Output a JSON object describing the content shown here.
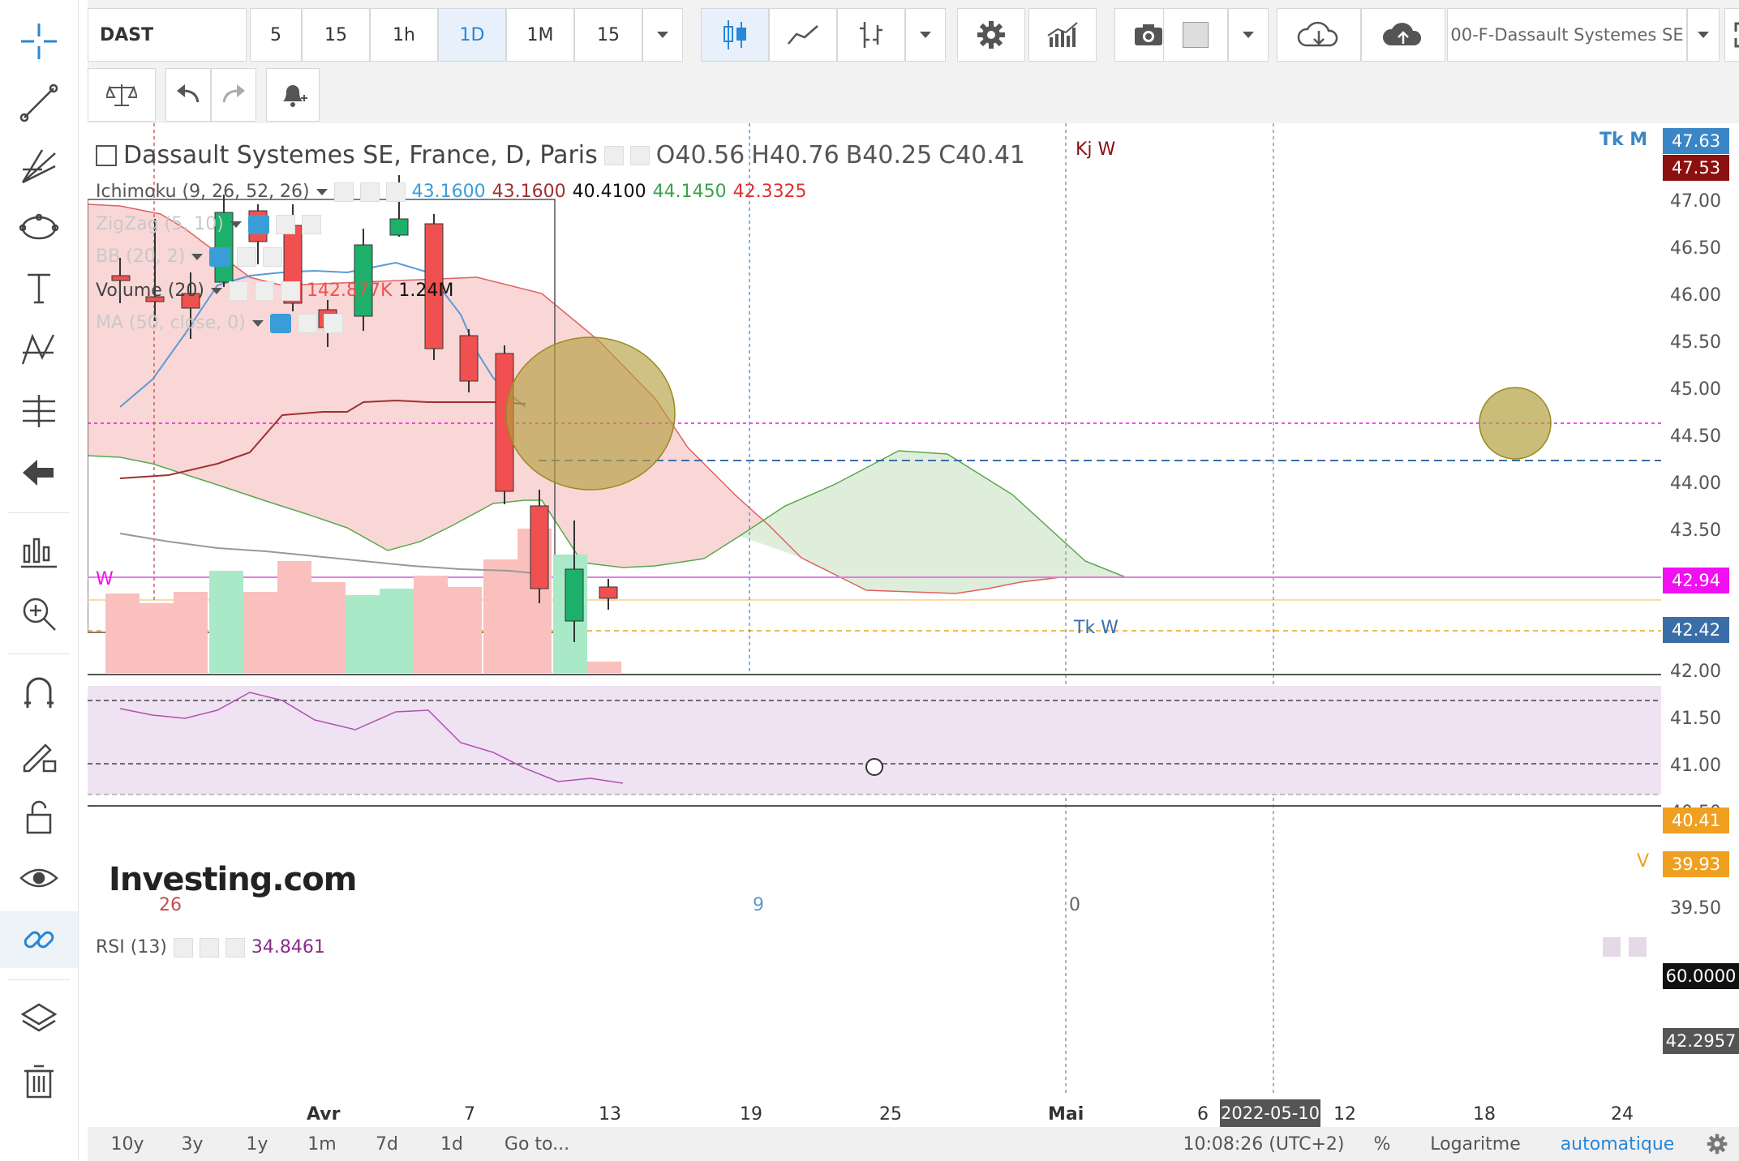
{
  "toolbar": {
    "symbol": "DAST",
    "intervals": [
      "5",
      "15",
      "1h",
      "1D",
      "1M",
      "15"
    ],
    "active_interval": "1D",
    "instrument": "00-F-Dassault Systemes SE"
  },
  "legend": {
    "title": "Dassault Systemes SE, France, D, Paris",
    "ohlc": {
      "o": "O40.56",
      "h": "H40.76",
      "b": "B40.25",
      "c": "C40.41"
    },
    "ichimoku_label": "Ichimoku (9, 26, 52, 26)",
    "ichimoku_values": [
      "43.1600",
      "43.1600",
      "40.4100",
      "44.1450",
      "42.3325"
    ],
    "zigzag_label": "ZigZag (5, 10)",
    "bb_label": "BB (20, 2)",
    "volume_label": "Volume (20)",
    "volume_values": [
      "142.877K",
      "1.24M"
    ],
    "ma_label": "MA (50, close, 0)",
    "rsi_label": "RSI (13)",
    "rsi_value": "34.8461"
  },
  "price_axis": {
    "ticks": [
      "47.00",
      "46.50",
      "46.00",
      "45.50",
      "45.00",
      "44.50",
      "44.00",
      "43.50",
      "42.00",
      "41.50",
      "41.00",
      "40.50",
      "39.50"
    ],
    "badges": [
      {
        "value": "47.63",
        "color": "#3b86c6"
      },
      {
        "value": "47.53",
        "color": "#8b1010"
      },
      {
        "value": "42.94",
        "color": "#f010f0"
      },
      {
        "value": "42.42",
        "color": "#3b6ea8"
      },
      {
        "value": "40.41",
        "color": "#f0a020"
      },
      {
        "value": "39.93",
        "color": "#f0a020"
      }
    ],
    "rsi_badges": [
      "60.0000",
      "42.2957"
    ]
  },
  "annotations": {
    "tk_m": "Tk M",
    "kj_w": "Kj W",
    "tk_w": "Tk W",
    "w": "W",
    "v": "V",
    "marker_26": "26",
    "marker_9": "9",
    "marker_0": "0",
    "watermark": "Investing.com"
  },
  "time_axis": {
    "labels": [
      "Avr",
      "7",
      "13",
      "19",
      "25",
      "Mai",
      "6",
      "12",
      "18",
      "24"
    ],
    "cursor_date": "2022-05-10"
  },
  "timebar": {
    "ranges": [
      "10y",
      "3y",
      "1y",
      "1m",
      "7d",
      "1d"
    ],
    "goto": "Go to...",
    "clock": "10:08:26 (UTC+2)",
    "percent": "%",
    "log": "Logaritme",
    "auto": "automatique"
  },
  "colors": {
    "up": "#1db06a",
    "down": "#f0504f",
    "cloud_red": "#f9d5d5",
    "cloud_green": "#d8ecd4",
    "rsi_bg": "#efe2f2"
  }
}
